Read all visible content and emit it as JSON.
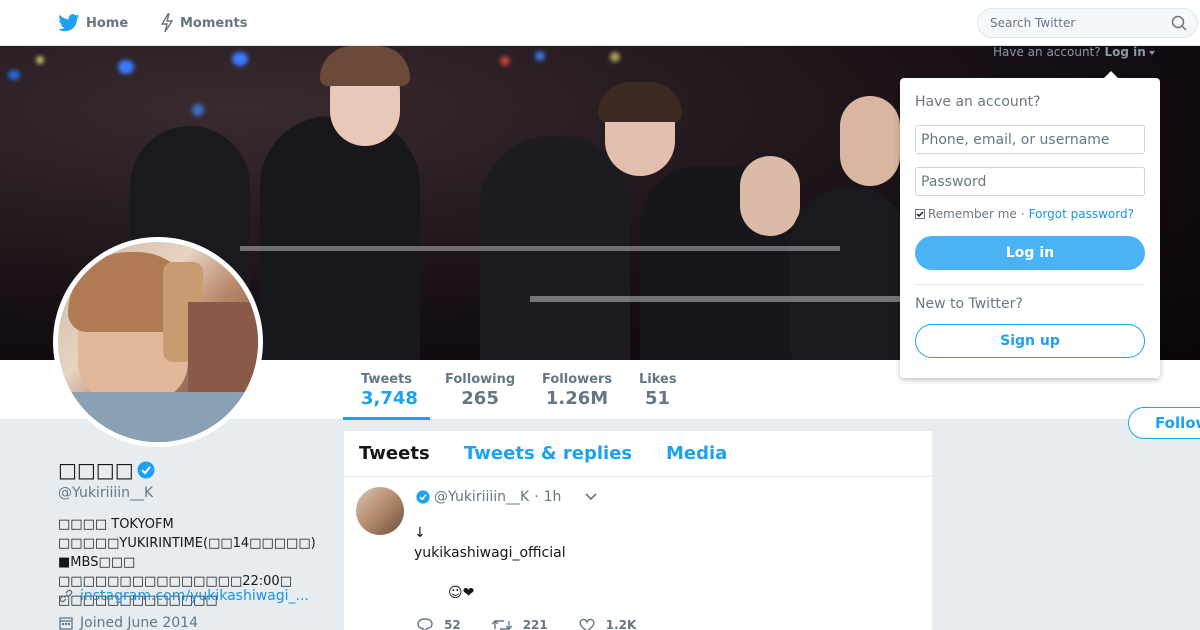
{
  "nav": {
    "home_label": "Home",
    "home_icon": "twitter-bird-icon",
    "moments_label": "Moments",
    "moments_icon": "lightning-icon",
    "search_placeholder": "Search Twitter",
    "search_icon": "search-icon"
  },
  "login": {
    "have_account_prefix": "Have an account?",
    "login_link": "Log in",
    "dropdown_title": "Have an account?",
    "username_placeholder": "Phone, email, or username",
    "password_placeholder": "Password",
    "remember_me": "Remember me",
    "separator": "·",
    "forgot_password": "Forgot password?",
    "login_button": "Log in",
    "new_to_twitter": "New to Twitter?",
    "signup_button": "Sign up"
  },
  "stats": [
    {
      "label": "Tweets",
      "value": "3,748"
    },
    {
      "label": "Following",
      "value": "265"
    },
    {
      "label": "Followers",
      "value": "1.26M"
    },
    {
      "label": "Likes",
      "value": "51"
    }
  ],
  "follow_button": "Follow",
  "profile": {
    "name": "□□□□",
    "handle": "@Yukiriiiin__K",
    "bio": "□□□□ TOKYOFM □□□□□YUKIRINTIME(□□14□□□□□) ■MBS□□□ □□□□□□□□□□□□□□□22:00□ □□□□□□□□□□□□□",
    "link": "instagram.com/yukikashiwagi_...",
    "joined": "Joined June 2014"
  },
  "timeline": {
    "tabs": [
      "Tweets",
      "Tweets & replies",
      "Media"
    ],
    "tweet": {
      "handle": "@Yukiriiiin__K",
      "dot": "·",
      "time": "1h",
      "line1": "↓",
      "line2": "yukikashiwagi_official",
      "emoji": "☺❤",
      "replies": "52",
      "retweets": "221",
      "likes": "1.2K"
    }
  },
  "colors": {
    "accent": "#1da1f2",
    "link": "#1b95e0",
    "muted": "#657786",
    "background": "#e6ecf0"
  }
}
